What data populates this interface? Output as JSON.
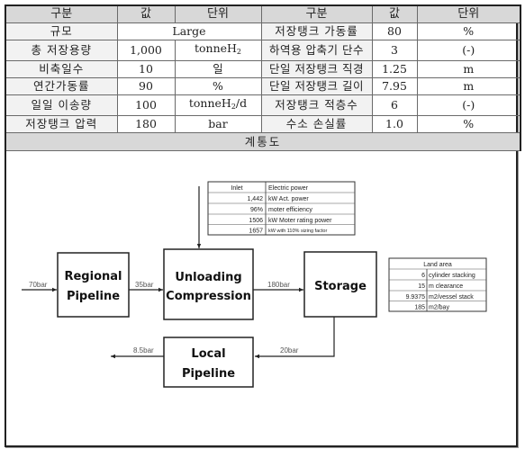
{
  "table": {
    "headers": [
      "구분",
      "값",
      "단위",
      "구분",
      "값",
      "단위"
    ],
    "scale_row": {
      "label": "규모",
      "value": "Large",
      "label2": "저장탱크 가동률",
      "value2": "80",
      "unit2": "%"
    },
    "rows": [
      {
        "label": "총 저장용량",
        "value": "1,000",
        "unit": "tonneH",
        "unit_sub": "2",
        "unit_suffix": "",
        "label2": "하역용 압축기 단수",
        "value2": "3",
        "unit2": "(-)"
      },
      {
        "label": "비축일수",
        "value": "10",
        "unit": "일",
        "unit_sub": "",
        "unit_suffix": "",
        "label2": "단일 저장탱크 직경",
        "value2": "1.25",
        "unit2": "m"
      },
      {
        "label": "연간가동률",
        "value": "90",
        "unit": "%",
        "unit_sub": "",
        "unit_suffix": "",
        "label2": "단일 저장탱크 길이",
        "value2": "7.95",
        "unit2": "m"
      },
      {
        "label": "일일 이송량",
        "value": "100",
        "unit": "tonneH",
        "unit_sub": "2",
        "unit_suffix": "/d",
        "label2": "저장탱크 적층수",
        "value2": "6",
        "unit2": "(-)"
      },
      {
        "label": "저장탱크 압력",
        "value": "180",
        "unit": "bar",
        "unit_sub": "",
        "unit_suffix": "",
        "label2": "수소 손실률",
        "value2": "1.0",
        "unit2": "%"
      }
    ],
    "section_title": "계통도"
  },
  "diagram": {
    "boxes": {
      "regional": [
        "Regional",
        "Pipeline"
      ],
      "unloading": [
        "Unloading",
        "Compression"
      ],
      "storage": [
        "Storage"
      ],
      "local": [
        "Local",
        "Pipeline"
      ]
    },
    "flows": {
      "inlet": "70bar",
      "regional_to_unloading": "35bar",
      "unloading_to_storage": "180bar",
      "storage_to_local": "20bar",
      "local_out": "8.5bar"
    },
    "power_table": {
      "header": [
        "Inlet",
        "Electric power"
      ],
      "rows": [
        [
          "1,442",
          "kW Act. power"
        ],
        [
          "96%",
          "moter efficiency"
        ],
        [
          "1506",
          "kW Moter rating power"
        ],
        [
          "1657",
          "kW with 110% sizing factor"
        ]
      ]
    },
    "land_table": {
      "header": "Land area",
      "rows": [
        [
          "6",
          "cylinder stacking"
        ],
        [
          "15",
          "m clearance"
        ],
        [
          "9.9375",
          "m2/vessel stack"
        ],
        [
          "185",
          "m2/bay"
        ]
      ]
    }
  }
}
